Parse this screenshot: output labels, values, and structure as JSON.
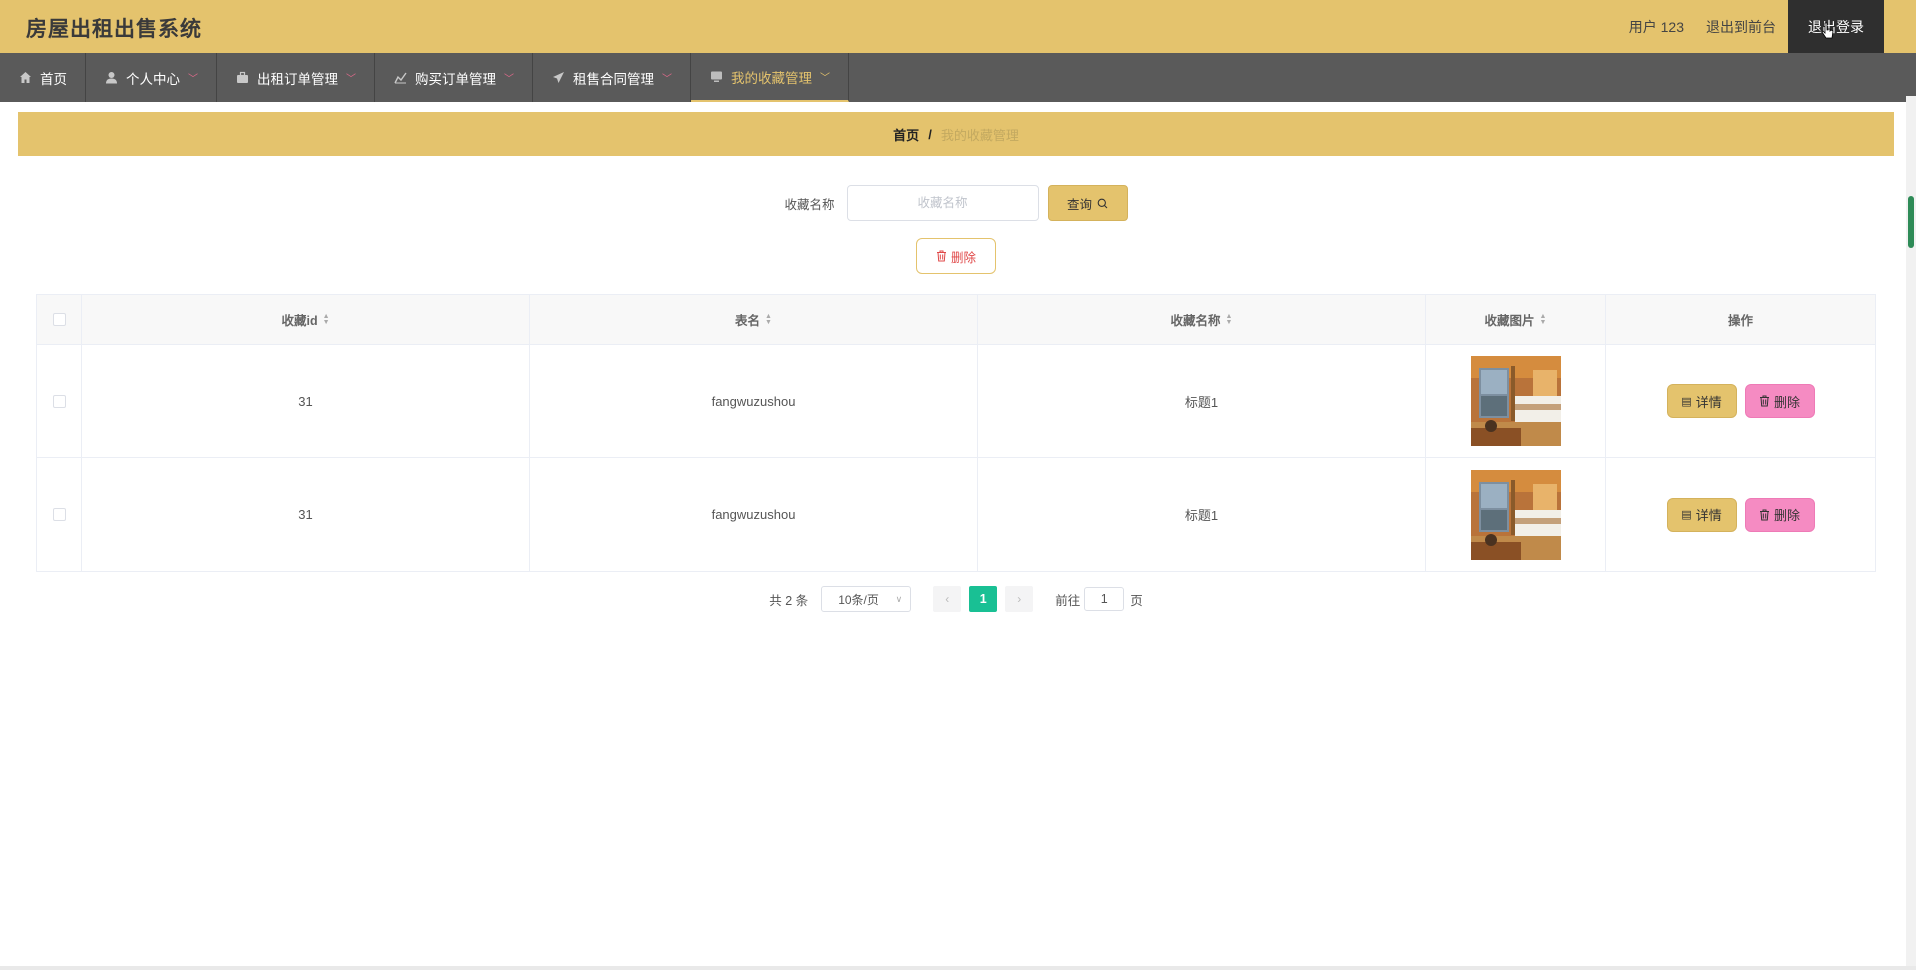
{
  "app": {
    "title": "房屋出租出售系统"
  },
  "header": {
    "user_label": "用户 123",
    "back_link": "退出到前台",
    "logout": "退出登录"
  },
  "nav": [
    {
      "label": "首页",
      "icon": "home-icon",
      "has_dropdown": false,
      "active": false
    },
    {
      "label": "个人中心",
      "icon": "user-icon",
      "has_dropdown": true,
      "active": false
    },
    {
      "label": "出租订单管理",
      "icon": "briefcase-icon",
      "has_dropdown": true,
      "active": false
    },
    {
      "label": "购买订单管理",
      "icon": "chart-icon",
      "has_dropdown": true,
      "active": false
    },
    {
      "label": "租售合同管理",
      "icon": "send-icon",
      "has_dropdown": true,
      "active": false
    },
    {
      "label": "我的收藏管理",
      "icon": "monitor-icon",
      "has_dropdown": true,
      "active": true
    }
  ],
  "breadcrumb": {
    "home": "首页",
    "separator": "/",
    "current": "我的收藏管理"
  },
  "search": {
    "label": "收藏名称",
    "placeholder": "收藏名称",
    "value": "",
    "button": "查询"
  },
  "actions": {
    "delete": "删除"
  },
  "table": {
    "columns": [
      "收藏id",
      "表名",
      "收藏名称",
      "收藏图片",
      "操作"
    ],
    "rows": [
      {
        "id": "31",
        "table_name": "fangwuzushou",
        "name": "标题1",
        "image": "hotel-room-photo"
      },
      {
        "id": "31",
        "table_name": "fangwuzushou",
        "name": "标题1",
        "image": "hotel-room-photo"
      }
    ],
    "row_actions": {
      "detail": "详情",
      "delete": "删除"
    }
  },
  "pagination": {
    "total": "共 2 条",
    "page_size": "10条/页",
    "current_page": "1",
    "goto_label": "前往",
    "goto_value": "1",
    "page_suffix": "页"
  },
  "colors": {
    "accent": "#e4c36d",
    "nav_bg": "#5a5a5a",
    "page_active": "#19c094",
    "delete_pink": "#f58bc2"
  }
}
